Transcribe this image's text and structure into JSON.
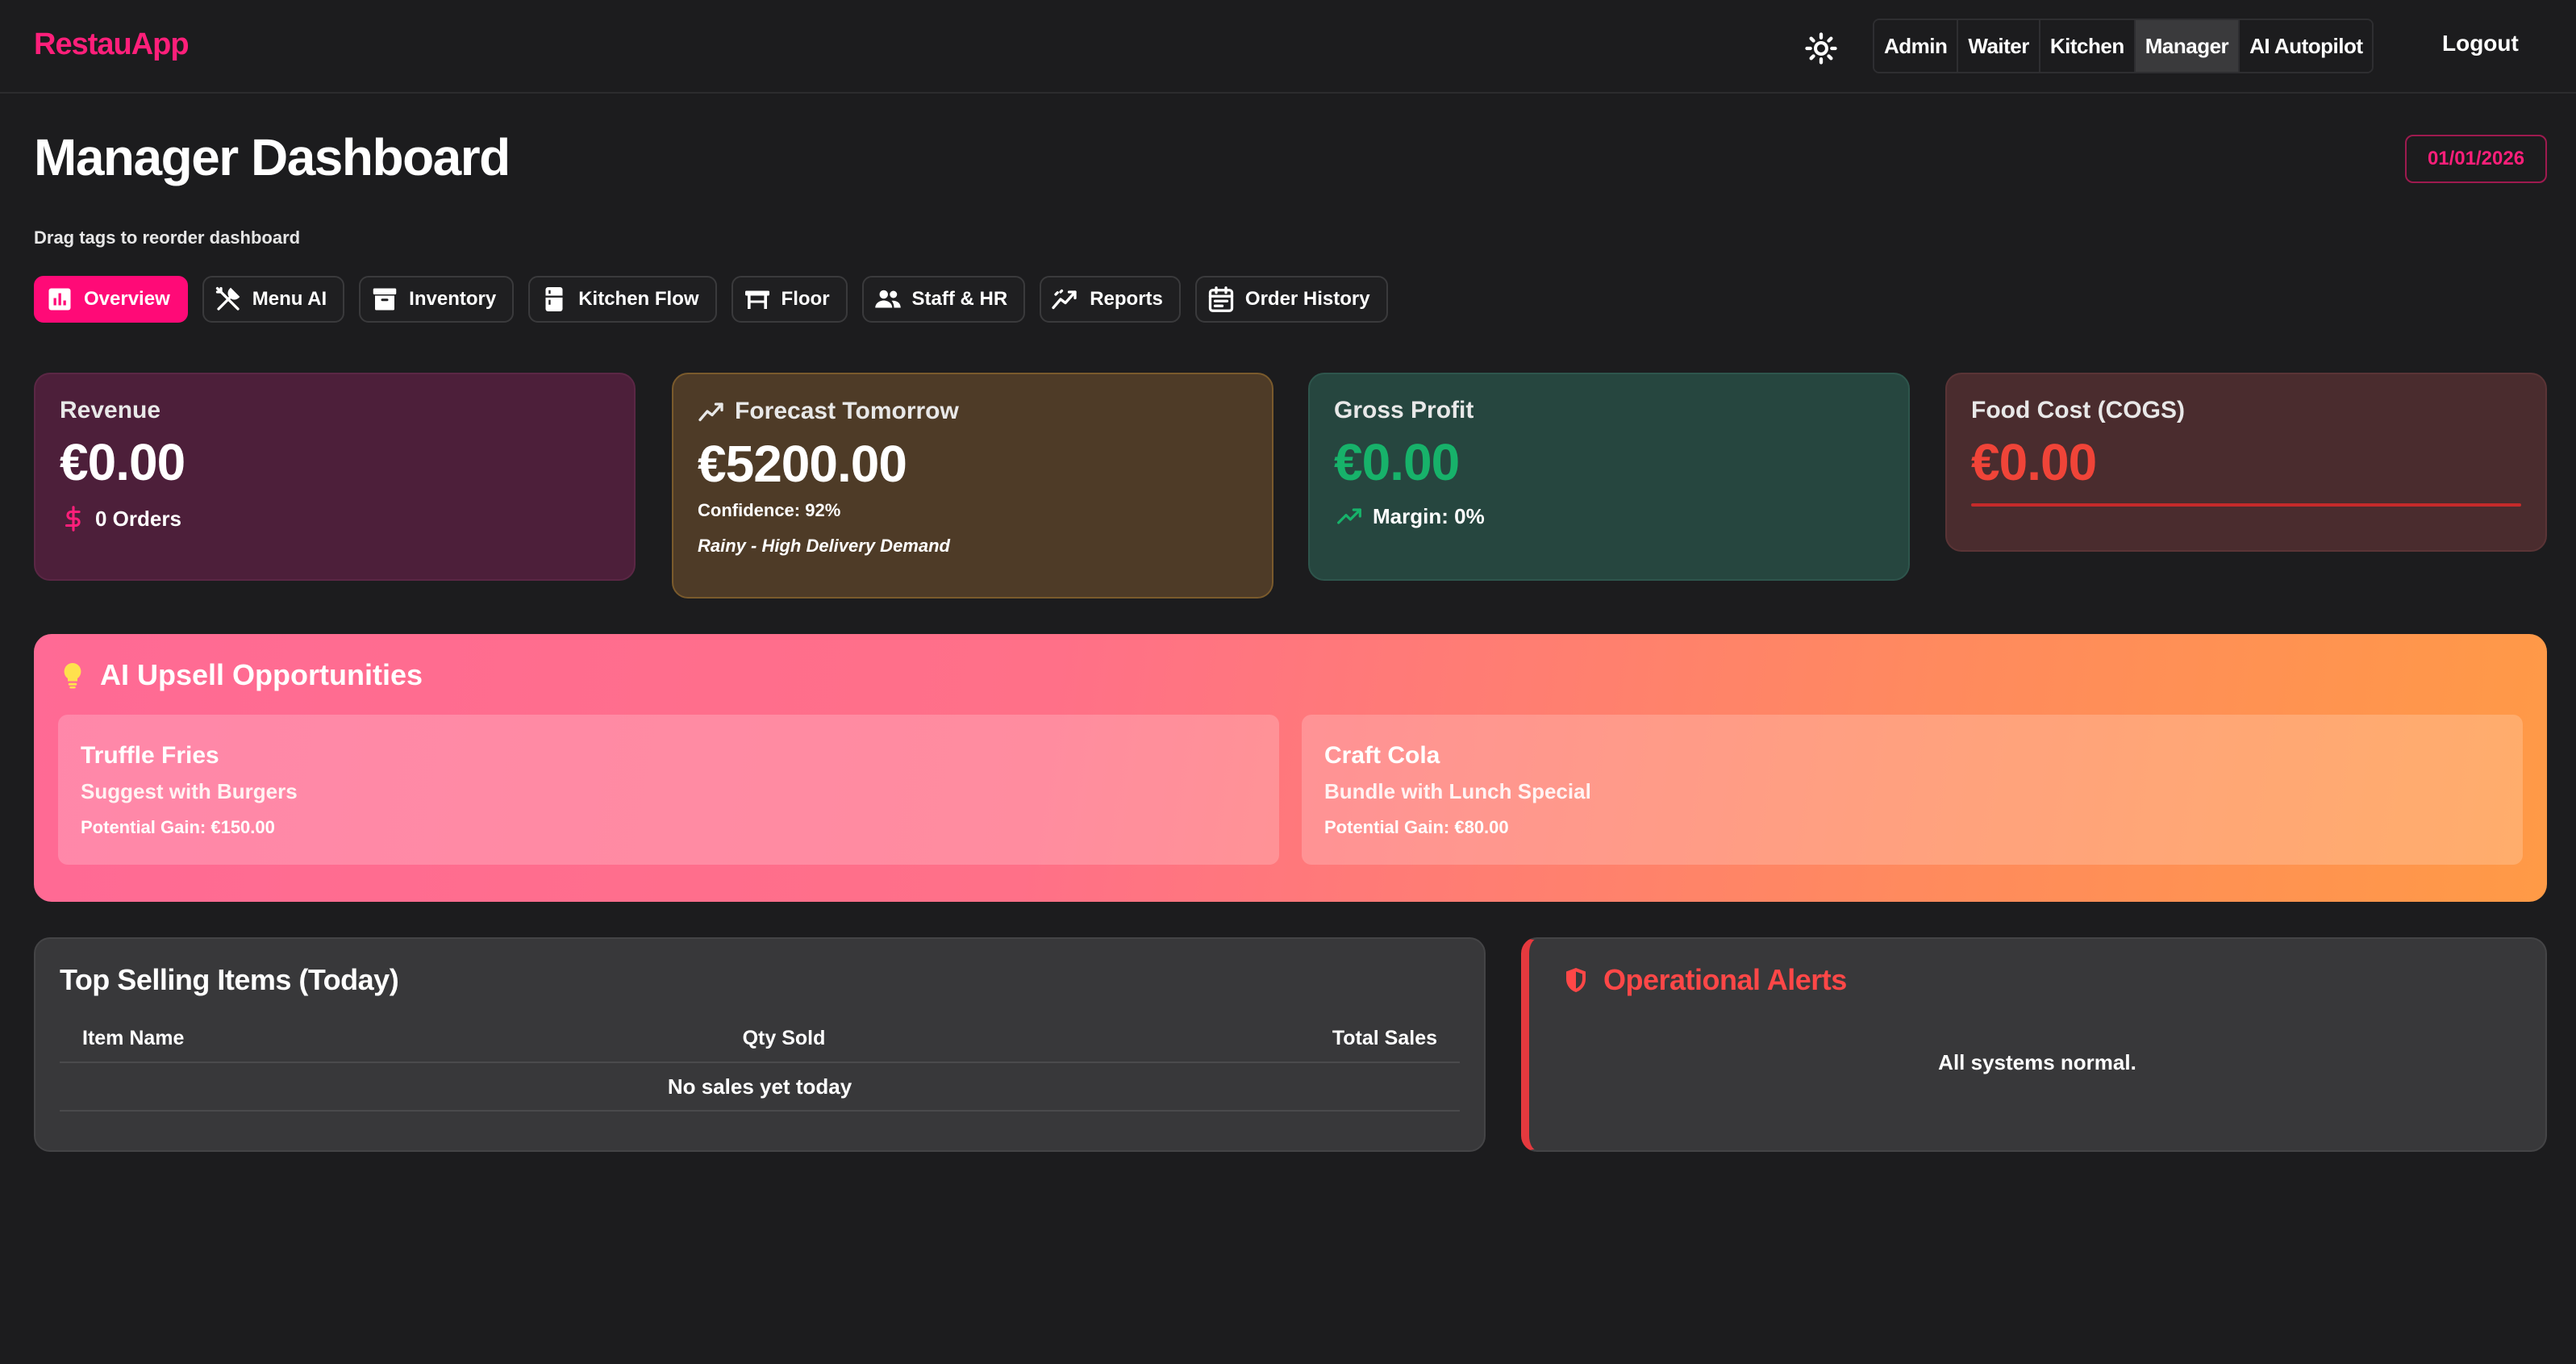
{
  "app": {
    "brand": "RestauApp",
    "roles": [
      "Admin",
      "Waiter",
      "Kitchen",
      "Manager",
      "AI Autopilot"
    ],
    "active_role": "Manager",
    "logout_label": "Logout"
  },
  "header": {
    "title": "Manager Dashboard",
    "date": "01/01/2026",
    "hint": "Drag tags to reorder dashboard"
  },
  "tabs": [
    {
      "label": "Overview",
      "icon": "bar-chart-icon",
      "active": true
    },
    {
      "label": "Menu AI",
      "icon": "utensils-icon",
      "active": false
    },
    {
      "label": "Inventory",
      "icon": "archive-icon",
      "active": false
    },
    {
      "label": "Kitchen Flow",
      "icon": "fridge-icon",
      "active": false
    },
    {
      "label": "Floor",
      "icon": "table-icon",
      "active": false
    },
    {
      "label": "Staff & HR",
      "icon": "people-icon",
      "active": false
    },
    {
      "label": "Reports",
      "icon": "trend-icon",
      "active": false
    },
    {
      "label": "Order History",
      "icon": "calendar-icon",
      "active": false
    }
  ],
  "stats": {
    "revenue": {
      "label": "Revenue",
      "value": "€0.00",
      "sub": "0 Orders"
    },
    "forecast": {
      "label": "Forecast Tomorrow",
      "value": "€5200.00",
      "confidence": "Confidence: 92%",
      "note": "Rainy - High Delivery Demand"
    },
    "profit": {
      "label": "Gross Profit",
      "value": "€0.00",
      "sub": "Margin: 0%"
    },
    "cogs": {
      "label": "Food Cost (COGS)",
      "value": "€0.00"
    }
  },
  "upsell": {
    "title": "AI Upsell Opportunities",
    "items": [
      {
        "name": "Truffle Fries",
        "desc": "Suggest with Burgers",
        "gain": "Potential Gain: €150.00"
      },
      {
        "name": "Craft Cola",
        "desc": "Bundle with Lunch Special",
        "gain": "Potential Gain: €80.00"
      }
    ]
  },
  "top_selling": {
    "title": "Top Selling Items (Today)",
    "columns": [
      "Item Name",
      "Qty Sold",
      "Total Sales"
    ],
    "empty": "No sales yet today"
  },
  "alerts": {
    "title": "Operational Alerts",
    "message": "All systems normal."
  },
  "colors": {
    "accent": "#ff0a77",
    "profit": "#17b26a",
    "cogs": "#f04438",
    "alert": "#ff4747"
  }
}
